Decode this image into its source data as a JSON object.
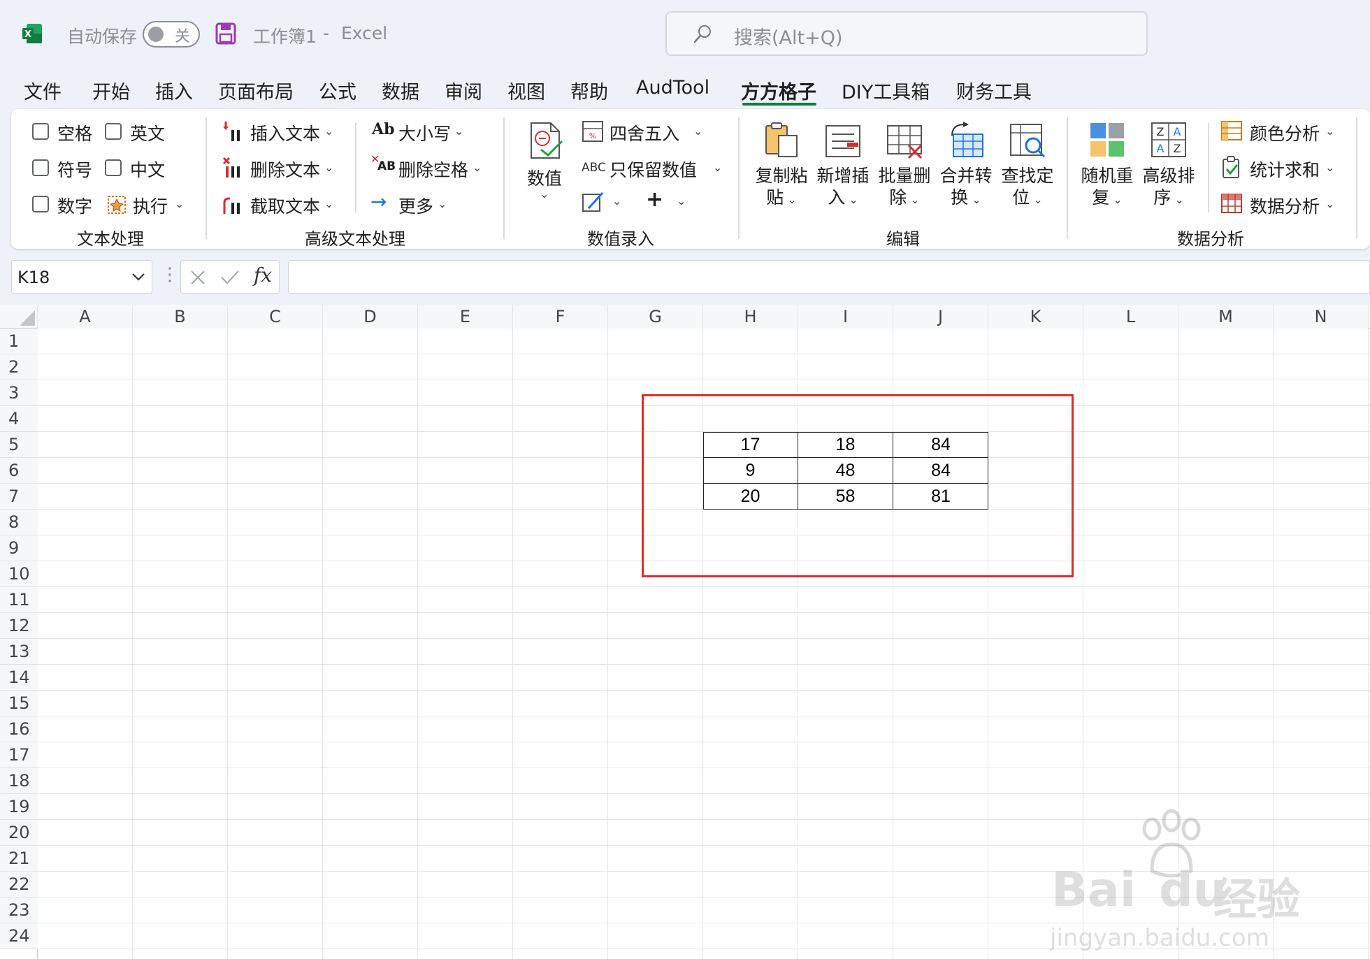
{
  "titlebar": {
    "autosave_label": "自动保存",
    "autosave_state": "关",
    "document_title": "工作簿1",
    "separator": "-",
    "app_name": "Excel",
    "search_placeholder": "搜索(Alt+Q)"
  },
  "menu_tabs": [
    "文件",
    "开始",
    "插入",
    "页面布局",
    "公式",
    "数据",
    "审阅",
    "视图",
    "帮助",
    "AudTool",
    "方方格子",
    "DIY工具箱",
    "财务工具"
  ],
  "active_tab": "方方格子",
  "ribbon": {
    "text_processing": {
      "label": "文本处理",
      "checkboxes": [
        "空格",
        "英文",
        "符号",
        "中文",
        "数字"
      ],
      "execute": "执行"
    },
    "advanced_text": {
      "label": "高级文本处理",
      "insert_text": "插入文本",
      "delete_text": "删除文本",
      "extract_text": "截取文本",
      "case": "大小写",
      "delete_space": "删除空格",
      "more": "更多",
      "case_icon_text": "Ab",
      "space_icon_text": "AB"
    },
    "value_input": {
      "label": "数值录入",
      "value_btn": "数值",
      "round": "四舍五入",
      "keep_values": "只保留数值",
      "abc": "ABC",
      "plus": "+"
    },
    "edit": {
      "label": "编辑",
      "copy_paste": [
        "复制粘",
        "贴"
      ],
      "insert_new": [
        "新增插",
        "入"
      ],
      "batch_delete": [
        "批量删",
        "除"
      ],
      "merge_convert": [
        "合并转",
        "换"
      ],
      "find_locate": [
        "查找定",
        "位"
      ]
    },
    "data_analysis": {
      "label": "数据分析",
      "random_repeat": [
        "随机重",
        "复"
      ],
      "advanced_sort": [
        "高级排",
        "序"
      ],
      "color_analysis": "颜色分析",
      "stat_sum": "统计求和",
      "data_analysis": "数据分析"
    }
  },
  "formula_bar": {
    "name_box": "K18",
    "fx_label": "fx",
    "formula": ""
  },
  "sheet": {
    "columns": [
      "A",
      "B",
      "C",
      "D",
      "E",
      "F",
      "G",
      "H",
      "I",
      "J",
      "K",
      "L",
      "M",
      "N"
    ],
    "rows": [
      "1",
      "2",
      "3",
      "4",
      "5",
      "6",
      "7",
      "8",
      "9",
      "10",
      "11",
      "12",
      "13",
      "14",
      "15",
      "16",
      "17",
      "18",
      "19",
      "20",
      "21",
      "22",
      "23",
      "24"
    ],
    "table": [
      [
        "17",
        "18",
        "84"
      ],
      [
        "9",
        "48",
        "84"
      ],
      [
        "20",
        "58",
        "81"
      ]
    ]
  },
  "watermark": {
    "brand_a": "Bai",
    "brand_b": "du",
    "cn": "经验",
    "url": "jingyan.baidu.com"
  },
  "colors": {
    "excel_green": "#107c41",
    "highlight_red": "#e02b2b"
  }
}
